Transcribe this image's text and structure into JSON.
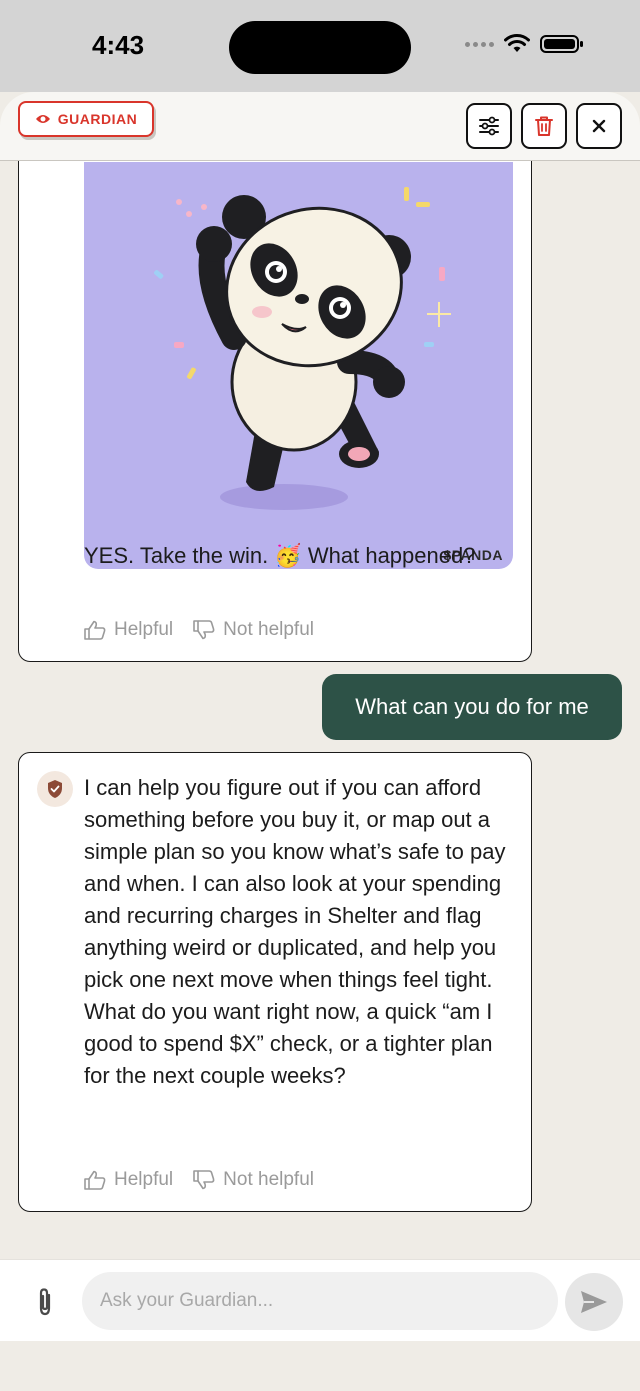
{
  "status": {
    "time": "4:43"
  },
  "header": {
    "badge_label": "GUARDIAN"
  },
  "messages": {
    "first": {
      "image_tag": "$PANDA",
      "text": "YES. Take the win. 🥳 What happened?",
      "helpful": "Helpful",
      "not_helpful": "Not helpful"
    },
    "user": {
      "text": "What can you do for me"
    },
    "second": {
      "text": "I can help you figure out if you can afford something before you buy it, or map out a simple plan so you know what’s safe to pay and when. I can also look at your spending and recurring charges in Shelter and flag anything weird or duplicated, and help you pick one next move when things feel tight. What do you want right now, a quick “am I good to spend $X” check, or a tighter plan for the next couple weeks?",
      "helpful": "Helpful",
      "not_helpful": "Not helpful"
    }
  },
  "input": {
    "placeholder": "Ask your Guardian..."
  },
  "colors": {
    "accent_red": "#d9352b",
    "user_bubble": "#2d5247",
    "background": "#efece6"
  }
}
